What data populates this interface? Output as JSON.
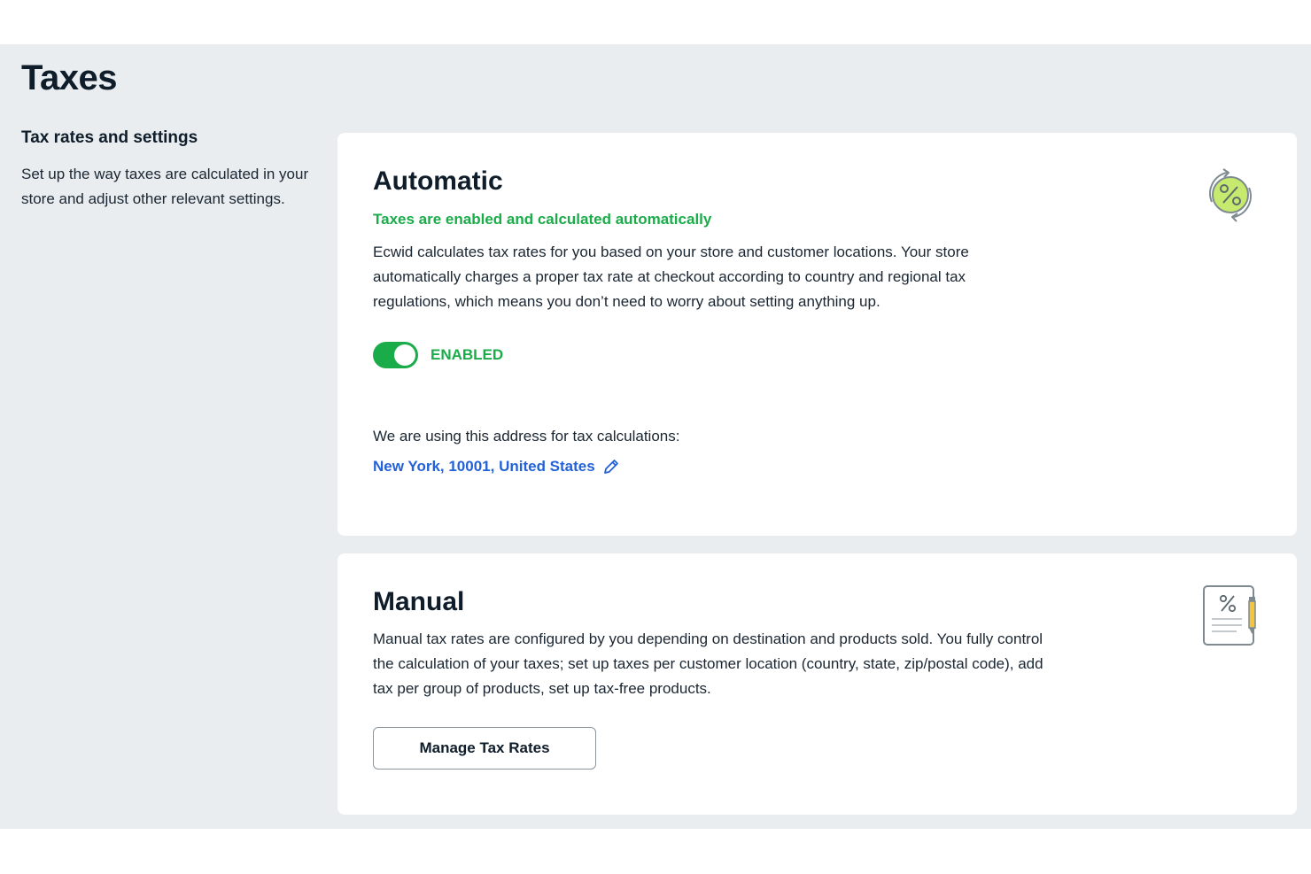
{
  "page": {
    "title": "Taxes"
  },
  "sidebar": {
    "title": "Tax rates and settings",
    "description": "Set up the way taxes are calculated in your store and adjust other relevant settings."
  },
  "automatic": {
    "title": "Automatic",
    "status": "Taxes are enabled and calculated automatically",
    "description": "Ecwid calculates tax rates for you based on your store and customer locations. Your store automatically charges a proper tax rate at checkout according to country and regional tax regulations, which means you don’t need to worry about setting anything up.",
    "toggle_label": "ENABLED",
    "toggle_on": true,
    "address_label": "We are using this address for tax calculations:",
    "address": "New York, 10001, United States",
    "icon": "percent-cycle-icon"
  },
  "manual": {
    "title": "Manual",
    "description": "Manual tax rates are configured by you depending on destination and products sold. You fully control the calculation of your taxes; set up taxes per customer location (country, state, zip/postal code), add tax per group of products, set up tax-free products.",
    "button_label": "Manage Tax Rates",
    "icon": "percent-document-icon"
  },
  "colors": {
    "accent_green": "#1aac49",
    "link_blue": "#2361d8",
    "page_bg": "#e9edf0",
    "text_dark": "#0f1d2b"
  }
}
